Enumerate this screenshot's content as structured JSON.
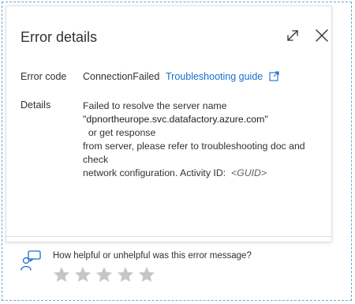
{
  "dialog": {
    "title": "Error details",
    "expand_icon": "expand-icon",
    "close_icon": "close-icon"
  },
  "error_code": {
    "label": "Error code",
    "value": "ConnectionFailed",
    "link_text": "Troubleshooting guide",
    "link_icon": "external-link-icon"
  },
  "details": {
    "label": "Details",
    "line1": "Failed to resolve the server name",
    "host": "\"dpnortheurope.svc.datafactory.azure.com\"",
    "line2_after_host": "  or get response",
    "line3": "from server, please refer to troubleshooting doc and check",
    "line4_prefix": "network configuration. Activity ID:  ",
    "guid": "<GUID>"
  },
  "feedback": {
    "question": "How helpful or unhelpful was this error message?",
    "icon": "feedback-person-icon",
    "rating": 0,
    "max_rating": 5
  },
  "colors": {
    "link": "#1a6fc9",
    "text": "#323130",
    "star": "#c8c6c4"
  }
}
